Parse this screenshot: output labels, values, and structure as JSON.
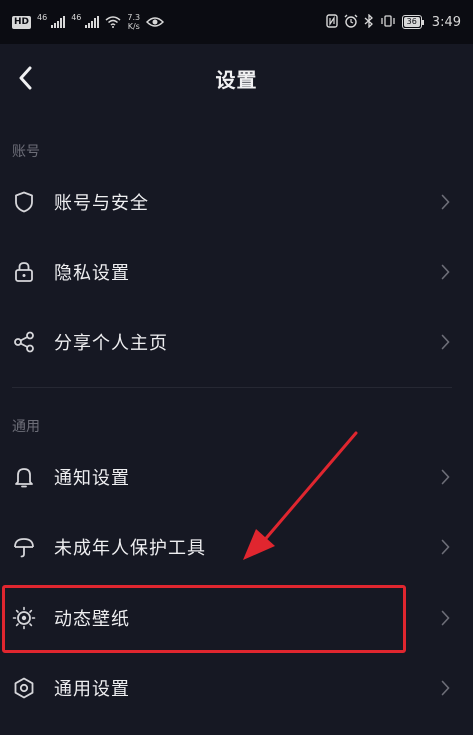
{
  "status_bar": {
    "hd_badge": "HD",
    "net1": "46",
    "net2": "46",
    "speed_value": "7.3",
    "speed_unit": "K/s",
    "battery": "36",
    "time": "3:49"
  },
  "header": {
    "title": "设置"
  },
  "sections": [
    {
      "label": "账号",
      "items": [
        {
          "label": "账号与安全",
          "icon": "shield-icon"
        },
        {
          "label": "隐私设置",
          "icon": "lock-icon"
        },
        {
          "label": "分享个人主页",
          "icon": "share-icon"
        }
      ]
    },
    {
      "label": "通用",
      "items": [
        {
          "label": "通知设置",
          "icon": "bell-icon"
        },
        {
          "label": "未成年人保护工具",
          "icon": "umbrella-icon"
        },
        {
          "label": "动态壁纸",
          "icon": "wallpaper-icon"
        },
        {
          "label": "通用设置",
          "icon": "hexagon-icon"
        }
      ]
    }
  ],
  "colors": {
    "background": "#161823",
    "status_bar": "#0b0c12",
    "annotation": "#e0262f"
  }
}
